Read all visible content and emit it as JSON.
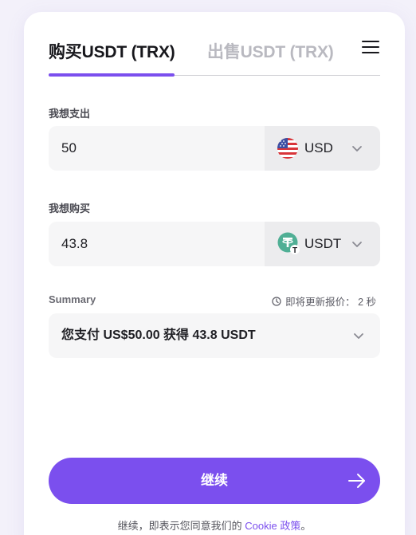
{
  "tabs": {
    "buy_label": "购买USDT (TRX)",
    "sell_label": "出售USDT (TRX)"
  },
  "pay": {
    "label": "我想支出",
    "amount": "50",
    "currency": "USD",
    "currency_icon": "us-flag-icon"
  },
  "receive": {
    "label": "我想购买",
    "amount": "43.8",
    "currency": "USDT",
    "currency_icon": "tether-icon"
  },
  "summary": {
    "label": "Summary",
    "refresh_text": "即将更新报价： 2 秒",
    "text": "您支付 US$50.00 获得 43.8 USDT"
  },
  "cta": {
    "label": "继续"
  },
  "footer": {
    "prefix": "继续，即表示您同意我们的 ",
    "link": "Cookie 政策",
    "suffix": "。"
  },
  "colors": {
    "accent": "#7b4fee",
    "tether": "#50af95"
  }
}
